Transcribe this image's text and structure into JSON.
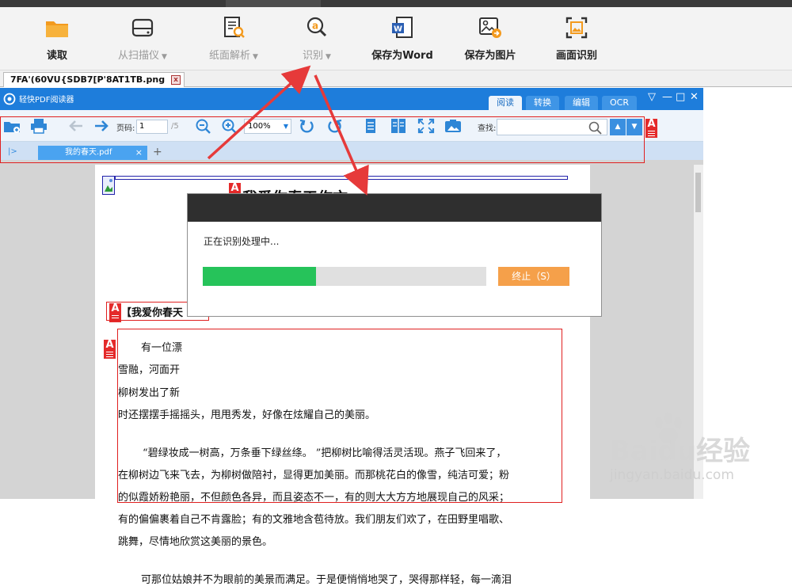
{
  "colors": {
    "accent": "#1e7ddb",
    "progress": "#26c35a",
    "stop_button": "#f5a04a",
    "annotation_red": "#e42a2a"
  },
  "ribbon": {
    "items": [
      {
        "label": "读取",
        "icon": "folder-icon",
        "enabled": true
      },
      {
        "label": "从扫描仪",
        "icon": "scanner-icon",
        "enabled": false
      },
      {
        "label": "纸面解析",
        "icon": "document-search-icon",
        "enabled": false
      },
      {
        "label": "识别",
        "icon": "recognize-icon",
        "enabled": false
      },
      {
        "label": "保存为Word",
        "icon": "word-icon",
        "enabled": true
      },
      {
        "label": "保存为图片",
        "icon": "save-image-icon",
        "enabled": true
      },
      {
        "label": "画面识别",
        "icon": "screen-capture-icon",
        "enabled": true
      }
    ],
    "dropdown_caret": "▼"
  },
  "file_tab": {
    "name": "7FA'(60VU{SDB7[P'8AT1TB.png",
    "close": "x"
  },
  "reader": {
    "title": "轻快PDF阅读器",
    "mode_tabs": [
      "阅读",
      "转换",
      "编辑",
      "OCR"
    ],
    "window_controls": [
      "▽",
      "—",
      "□",
      "✕"
    ],
    "toolbar": {
      "page_label": "页码:",
      "page_value": "1",
      "page_total": "/5",
      "zoom_value": "100%",
      "find_label": "查找:"
    },
    "doc_tab": {
      "name": "我的春天.pdf",
      "close": "×",
      "add": "+",
      "sidebar_toggle": "|>"
    }
  },
  "document": {
    "title": "我爱你春天作文",
    "subtitle": "【我爱你春天",
    "lines": [
      "有一位漂",
      "雪融，河面开",
      "柳树发出了新",
      "时还摆摆手摇摇头，甩甩秀发，好像在炫耀自己的美丽。",
      "“碧绿妆成一树高，万条垂下绿丝绦。 ”把柳树比喻得活灵活现。燕子飞回来了，",
      "在柳树边飞来飞去，为柳树做陪衬，显得更加美丽。而那桃花白的像雪，纯洁可爱；粉",
      "的似霞娇粉艳丽，不但颜色各异，而且姿态不一，有的则大大方方地展现自己的风采；",
      "有的偏偏裹着自己不肯露脸；有的文雅地含苞待放。我们朋友们欢了，在田野里唱歌、",
      "跳舞，尽情地欣赏这美丽的景色。",
      "可那位姑娘并不为眼前的美景而满足。于是便悄悄地哭了，哭得那样轻，每一滴泪"
    ]
  },
  "dialog": {
    "message": "正在识别处理中...",
    "progress": 0.4,
    "stop_label": "终止（S）"
  },
  "watermark": {
    "main": "Baidu经验",
    "sub": "jingyan.baidu.com"
  }
}
